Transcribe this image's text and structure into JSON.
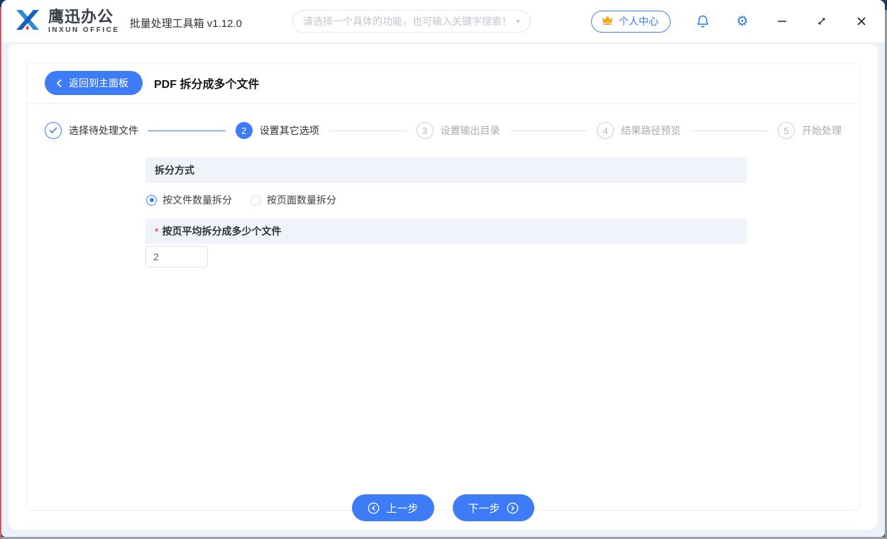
{
  "header": {
    "brand": "鹰迅办公",
    "brand_sub": "INXUN OFFICE",
    "app_title": "批量处理工具箱 v1.12.0",
    "search_placeholder": "请选择一个具体的功能，也可输入关键字搜索！",
    "user_center_label": "个人中心"
  },
  "toolbar": {
    "back_label": "返回到主面板",
    "page_title": "PDF 拆分成多个文件"
  },
  "steps": [
    {
      "num": "1",
      "label": "选择待处理文件",
      "state": "done"
    },
    {
      "num": "2",
      "label": "设置其它选项",
      "state": "active"
    },
    {
      "num": "3",
      "label": "设置输出目录",
      "state": "pending"
    },
    {
      "num": "4",
      "label": "结果路径预览",
      "state": "pending"
    },
    {
      "num": "5",
      "label": "开始处理",
      "state": "pending"
    }
  ],
  "form": {
    "section1": {
      "title": "拆分方式",
      "options": [
        {
          "label": "按文件数量拆分",
          "selected": true
        },
        {
          "label": "按页面数量拆分",
          "selected": false
        }
      ]
    },
    "section2": {
      "required_mark": "*",
      "title": "按页平均拆分成多少个文件",
      "value": "2"
    }
  },
  "footer": {
    "prev_label": "上一步",
    "next_label": "下一步"
  },
  "colors": {
    "accent": "#3d7cf6",
    "header_icon_blue": "#2b7de9",
    "crown_gold": "#f5a623",
    "required_red": "#f5576c",
    "step_inactive": "#a8abb2",
    "section_bar_bg": "#f0f4fa"
  }
}
